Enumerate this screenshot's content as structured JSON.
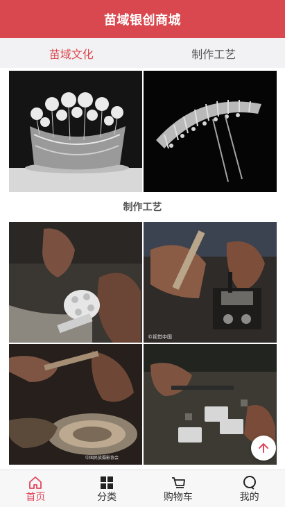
{
  "header": {
    "title": "苗域银创商城"
  },
  "tabs": [
    {
      "label": "苗域文化",
      "active": true
    },
    {
      "label": "制作工艺",
      "active": false
    }
  ],
  "gallery": {
    "top_images": [
      "silver-crown-photo",
      "silver-hairpin-photo"
    ],
    "section_title": "制作工艺",
    "craft_images": [
      "craft-flower-making-photo",
      "craft-hammering-photo",
      "craft-engraving-photo",
      "craft-stamping-photo"
    ],
    "watermarks": {
      "hammering": "©视觉中国",
      "engraving": "中国民族摄影协会"
    }
  },
  "fab": {
    "icon": "arrow-up-icon",
    "color": "#e2475c"
  },
  "bottom_nav": [
    {
      "label": "首页",
      "icon": "home-icon",
      "active": true
    },
    {
      "label": "分类",
      "icon": "grid-icon",
      "active": false
    },
    {
      "label": "购物车",
      "icon": "cart-icon",
      "active": false
    },
    {
      "label": "我的",
      "icon": "profile-icon",
      "active": false
    }
  ],
  "colors": {
    "brand": "#d9484e",
    "active_nav": "#e2475c",
    "tab_bg": "#f2f2f4"
  }
}
